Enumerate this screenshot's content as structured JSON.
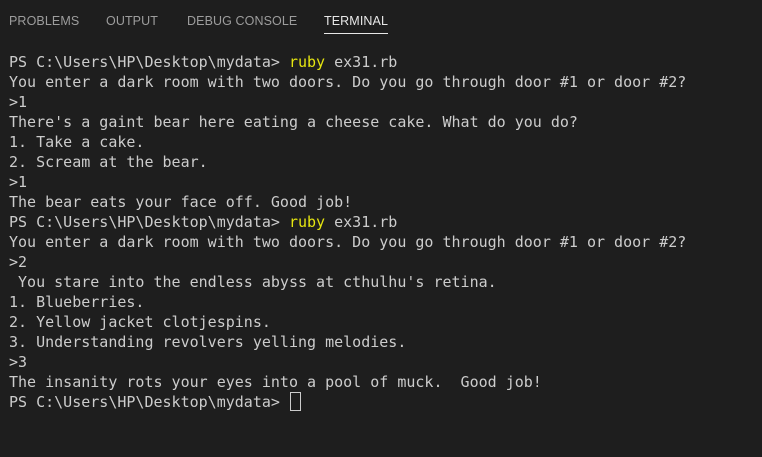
{
  "tabs": {
    "problems": "PROBLEMS",
    "output": "OUTPUT",
    "debug_console": "DEBUG CONSOLE",
    "terminal": "TERMINAL"
  },
  "terminal": {
    "lines": [
      {
        "prompt": "PS C:\\Users\\HP\\Desktop\\mydata> ",
        "cmd": "ruby",
        "args": " ex31.rb"
      },
      {
        "text": "You enter a dark room with two doors. Do you go through door #1 or door #2?"
      },
      {
        "text": ">1"
      },
      {
        "text": "There's a gaint bear here eating a cheese cake. What do you do?"
      },
      {
        "text": "1. Take a cake."
      },
      {
        "text": "2. Scream at the bear."
      },
      {
        "text": ">1"
      },
      {
        "text": "The bear eats your face off. Good job!"
      },
      {
        "prompt": "PS C:\\Users\\HP\\Desktop\\mydata> ",
        "cmd": "ruby",
        "args": " ex31.rb"
      },
      {
        "text": "You enter a dark room with two doors. Do you go through door #1 or door #2?"
      },
      {
        "text": ">2"
      },
      {
        "text": " You stare into the endless abyss at cthulhu's retina."
      },
      {
        "text": "1. Blueberries."
      },
      {
        "text": "2. Yellow jacket clotjespins."
      },
      {
        "text": "3. Understanding revolvers yelling melodies."
      },
      {
        "text": ">3"
      },
      {
        "text": "The insanity rots your eyes into a pool of muck.  Good job!"
      },
      {
        "prompt": "PS C:\\Users\\HP\\Desktop\\mydata> ",
        "cursor": true
      }
    ]
  },
  "colors": {
    "background": "#1e1e1e",
    "text": "#cccccc",
    "command": "#e5e510",
    "tab_inactive": "#9d9d9d",
    "tab_active": "#e7e7e7"
  }
}
